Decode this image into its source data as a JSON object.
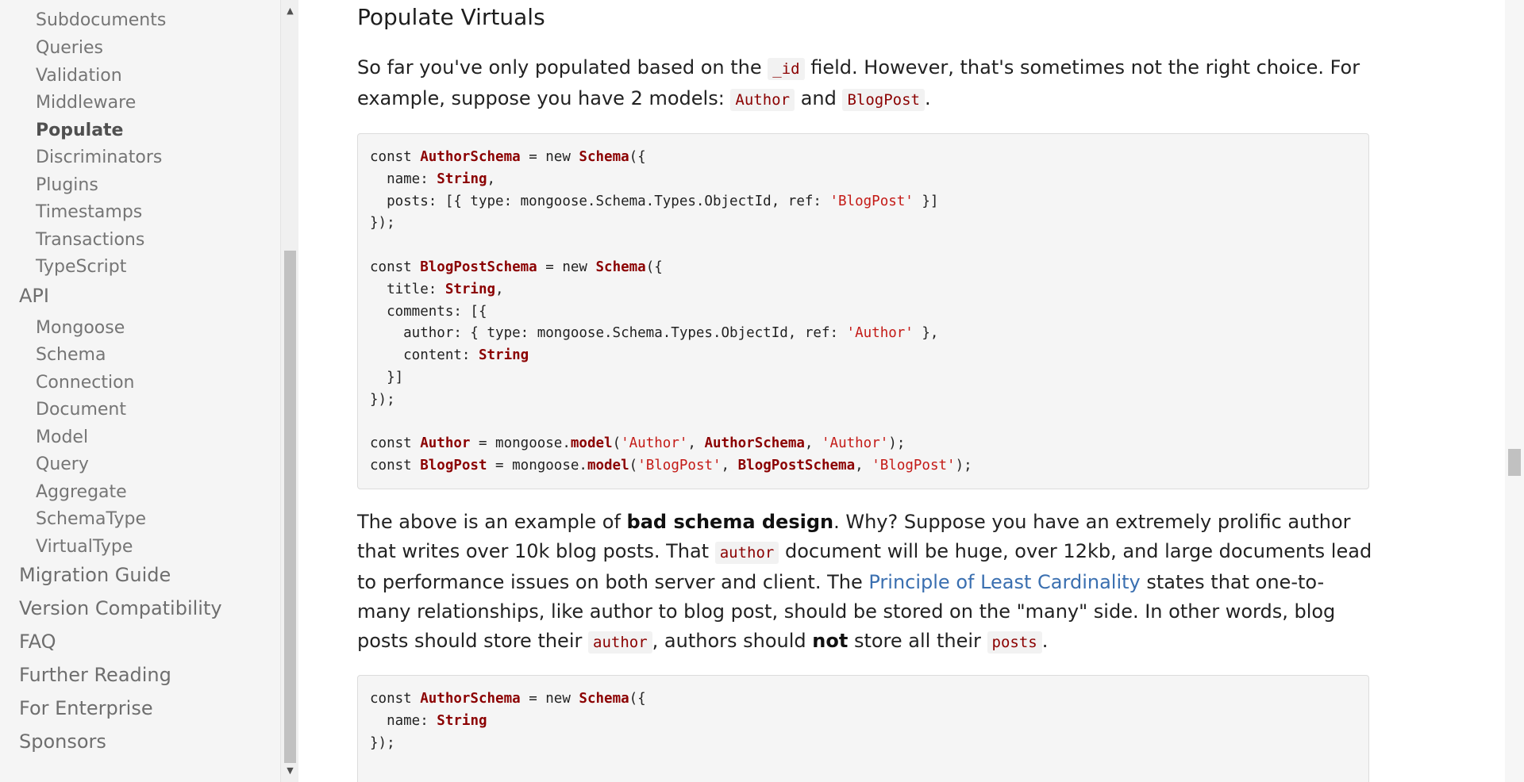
{
  "sidebar": {
    "sub_items_top": [
      {
        "label": "Subdocuments"
      },
      {
        "label": "Queries"
      },
      {
        "label": "Validation"
      },
      {
        "label": "Middleware"
      },
      {
        "label": "Populate"
      },
      {
        "label": "Discriminators"
      },
      {
        "label": "Plugins"
      },
      {
        "label": "Timestamps"
      },
      {
        "label": "Transactions"
      },
      {
        "label": "TypeScript"
      }
    ],
    "api_label": "API",
    "api_items": [
      {
        "label": "Mongoose"
      },
      {
        "label": "Schema"
      },
      {
        "label": "Connection"
      },
      {
        "label": "Document"
      },
      {
        "label": "Model"
      },
      {
        "label": "Query"
      },
      {
        "label": "Aggregate"
      },
      {
        "label": "SchemaType"
      },
      {
        "label": "VirtualType"
      }
    ],
    "top_items": [
      {
        "label": "Migration Guide"
      },
      {
        "label": "Version Compatibility"
      },
      {
        "label": "FAQ"
      },
      {
        "label": "Further Reading"
      },
      {
        "label": "For Enterprise"
      },
      {
        "label": "Sponsors"
      }
    ],
    "active": "Populate"
  },
  "main": {
    "heading": "Populate Virtuals",
    "p1": {
      "t1": "So far you've only populated based on the ",
      "c1": "_id",
      "t2": " field. However, that's sometimes not the right choice. For example, suppose you have 2 models: ",
      "c2": "Author",
      "t3": " and ",
      "c3": "BlogPost",
      "t4": "."
    },
    "p2": {
      "t1": "The above is an example of ",
      "b1": "bad schema design",
      "t2": ". Why? Suppose you have an extremely prolific author that writes over 10k blog posts. That ",
      "c1": "author",
      "t3": " document will be huge, over 12kb, and large documents lead to performance issues on both server and client. The ",
      "link": "Principle of Least Cardinality",
      "t4": " states that one-to-many relationships, like author to blog post, should be stored on the \"many\" side. In other words, blog posts should store their ",
      "c2": "author",
      "t5": ", authors should ",
      "b2": "not",
      "t6": " store all their ",
      "c3": "posts",
      "t7": "."
    },
    "code1": {
      "l1": {
        "a": "const ",
        "b": "AuthorSchema",
        "c": " = new ",
        "d": "Schema",
        "e": "({"
      },
      "l2": {
        "a": "  name: ",
        "b": "String",
        "c": ","
      },
      "l3": {
        "a": "  posts: [{ type: mongoose.Schema.Types.ObjectId, ref: ",
        "b": "'BlogPost'",
        "c": " }]"
      },
      "l4": "});",
      "l6": {
        "a": "const ",
        "b": "BlogPostSchema",
        "c": " = new ",
        "d": "Schema",
        "e": "({"
      },
      "l7": {
        "a": "  title: ",
        "b": "String",
        "c": ","
      },
      "l8": "  comments: [{",
      "l9": {
        "a": "    author: { type: mongoose.Schema.Types.ObjectId, ref: ",
        "b": "'Author'",
        "c": " },"
      },
      "l10": {
        "a": "    content: ",
        "b": "String"
      },
      "l11": "  }]",
      "l12": "});",
      "l14": {
        "a": "const ",
        "b": "Author",
        "c": " = mongoose.",
        "d": "model",
        "e": "(",
        "f": "'Author'",
        "g": ", ",
        "h": "AuthorSchema",
        "i": ", ",
        "j": "'Author'",
        "k": ");"
      },
      "l15": {
        "a": "const ",
        "b": "BlogPost",
        "c": " = mongoose.",
        "d": "model",
        "e": "(",
        "f": "'BlogPost'",
        "g": ", ",
        "h": "BlogPostSchema",
        "i": ", ",
        "j": "'BlogPost'",
        "k": ");"
      }
    },
    "code2": {
      "l1": {
        "a": "const ",
        "b": "AuthorSchema",
        "c": " = new ",
        "d": "Schema",
        "e": "({"
      },
      "l2": {
        "a": "  name: ",
        "b": "String"
      },
      "l3": "});"
    }
  }
}
